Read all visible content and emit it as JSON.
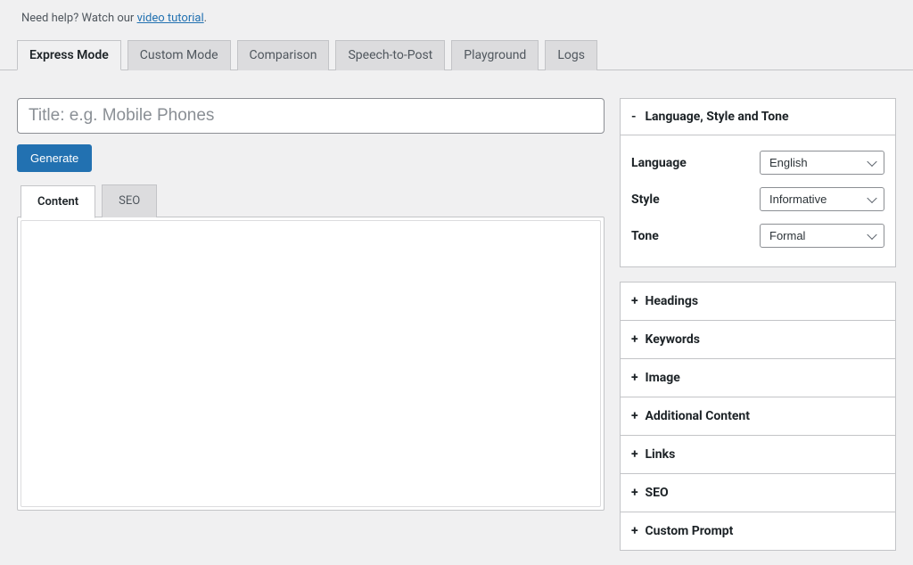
{
  "help": {
    "prefix": "Need help? Watch our ",
    "link": "video tutorial",
    "suffix": "."
  },
  "tabs": [
    {
      "label": "Express Mode",
      "active": true
    },
    {
      "label": "Custom Mode",
      "active": false
    },
    {
      "label": "Comparison",
      "active": false
    },
    {
      "label": "Speech-to-Post",
      "active": false
    },
    {
      "label": "Playground",
      "active": false
    },
    {
      "label": "Logs",
      "active": false
    }
  ],
  "title": {
    "value": "",
    "placeholder": "Title: e.g. Mobile Phones"
  },
  "generate_label": "Generate",
  "content_tabs": [
    {
      "label": "Content",
      "active": true
    },
    {
      "label": "SEO",
      "active": false
    }
  ],
  "sidebar": {
    "panel1": {
      "toggle": "-",
      "title": "Language, Style and Tone",
      "language_label": "Language",
      "language_value": "English",
      "style_label": "Style",
      "style_value": "Informative",
      "tone_label": "Tone",
      "tone_value": "Formal"
    },
    "collapsed": [
      {
        "toggle": "+",
        "title": "Headings"
      },
      {
        "toggle": "+",
        "title": "Keywords"
      },
      {
        "toggle": "+",
        "title": "Image"
      },
      {
        "toggle": "+",
        "title": "Additional Content"
      },
      {
        "toggle": "+",
        "title": "Links"
      },
      {
        "toggle": "+",
        "title": "SEO"
      },
      {
        "toggle": "+",
        "title": "Custom Prompt"
      }
    ]
  }
}
